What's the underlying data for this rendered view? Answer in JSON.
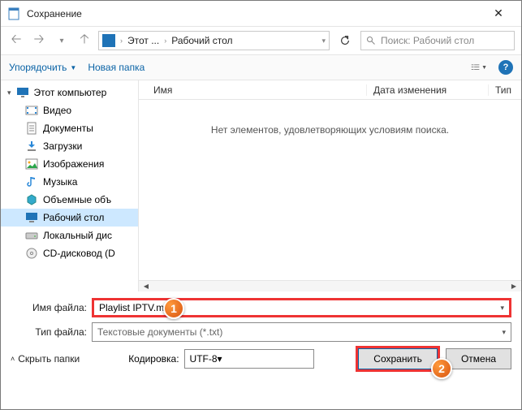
{
  "title": "Сохранение",
  "nav": {
    "path_part1": "Этот ...",
    "path_part2": "Рабочий стол",
    "search_placeholder": "Поиск: Рабочий стол"
  },
  "toolbar": {
    "organize": "Упорядочить",
    "newfolder": "Новая папка"
  },
  "tree": {
    "root": "Этот компьютер",
    "children": [
      "Видео",
      "Документы",
      "Загрузки",
      "Изображения",
      "Музыка",
      "Объемные объ",
      "Рабочий стол",
      "Локальный дис",
      "CD-дисковод (D"
    ]
  },
  "list": {
    "col_name": "Имя",
    "col_date": "Дата изменения",
    "col_type": "Тип",
    "empty_msg": "Нет элементов, удовлетворяющих условиям поиска."
  },
  "fields": {
    "filename_label": "Имя файла:",
    "filename_value": "Playlist IPTV.m3u",
    "filetype_label": "Тип файла:",
    "filetype_value": "Текстовые документы (*.txt)",
    "encoding_label": "Кодировка:",
    "encoding_value": "UTF-8"
  },
  "buttons": {
    "hide_folders": "Скрыть папки",
    "save": "Сохранить",
    "cancel": "Отмена"
  },
  "badges": {
    "one": "1",
    "two": "2"
  }
}
